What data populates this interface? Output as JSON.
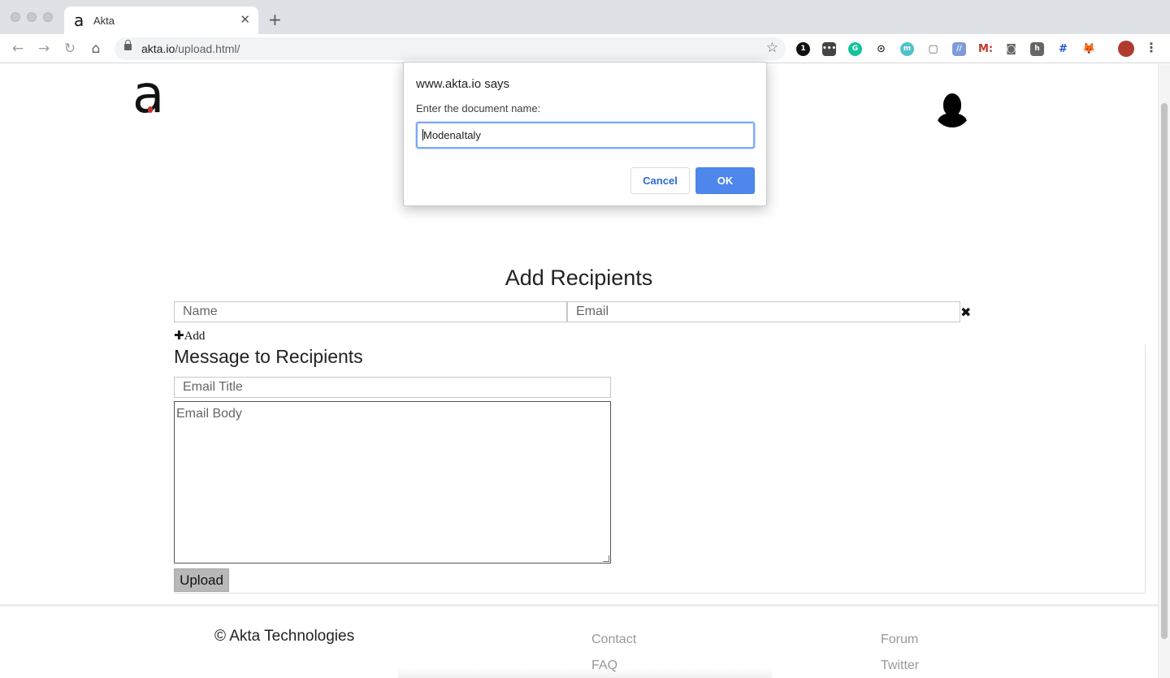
{
  "browser": {
    "tab": {
      "favicon": "a",
      "title": "Akta",
      "close": "✕"
    },
    "new_tab": "+",
    "nav": {
      "back": "←",
      "forward": "→",
      "reload": "↻",
      "home": "⌂"
    },
    "url": {
      "domain": "akta.io",
      "path": "/upload.html/"
    },
    "bookmark_icon": "☆",
    "extensions": [
      {
        "name": "1password-icon",
        "glyph": "1",
        "color": "#111111"
      },
      {
        "name": "dots-ext-icon",
        "glyph": "•••",
        "color": "#444444"
      },
      {
        "name": "grammarly-icon",
        "glyph": "G",
        "color": "#15c39a"
      },
      {
        "name": "target-ext-icon",
        "glyph": "⊙",
        "color": "#ffffff"
      },
      {
        "name": "teal-ext-icon",
        "glyph": "m",
        "color": "#4fc3c7"
      },
      {
        "name": "box-ext-icon",
        "glyph": "▢",
        "color": "#ffffff"
      },
      {
        "name": "blue-ext-icon",
        "glyph": "//",
        "color": "#7f9bd8"
      },
      {
        "name": "mailtrack-icon",
        "glyph": "M:",
        "color": "#ffffff"
      },
      {
        "name": "camera-ext-icon",
        "glyph": "◙",
        "color": "#ffffff"
      },
      {
        "name": "h-ext-icon",
        "glyph": "h",
        "color": "#666666"
      },
      {
        "name": "grid-ext-icon",
        "glyph": "#",
        "color": "#ffffff"
      },
      {
        "name": "metamask-icon",
        "glyph": "🦊",
        "color": "#ffffff"
      }
    ],
    "menu_icon": "⋮"
  },
  "page": {
    "logo": "a",
    "section_title": "Add Recipients",
    "name_placeholder": "Name",
    "email_placeholder": "Email",
    "remove_icon": "✖",
    "add_label": "Add",
    "add_icon": "✚",
    "message_title": "Message to Recipients",
    "email_title_placeholder": "Email Title",
    "email_body_placeholder": "Email Body",
    "upload_label": "Upload",
    "footer": {
      "copyright": "© Akta Technologies",
      "links_col1": [
        "Contact",
        "FAQ"
      ],
      "links_col2": [
        "Forum",
        "Twitter"
      ]
    }
  },
  "dialog": {
    "title": "www.akta.io says",
    "message": "Enter the document name:",
    "input_value": "ModenaItaly",
    "cancel_label": "Cancel",
    "ok_label": "OK"
  },
  "colors": {
    "accent": "#4f86ec",
    "cancel_text": "#2c6ad6"
  }
}
